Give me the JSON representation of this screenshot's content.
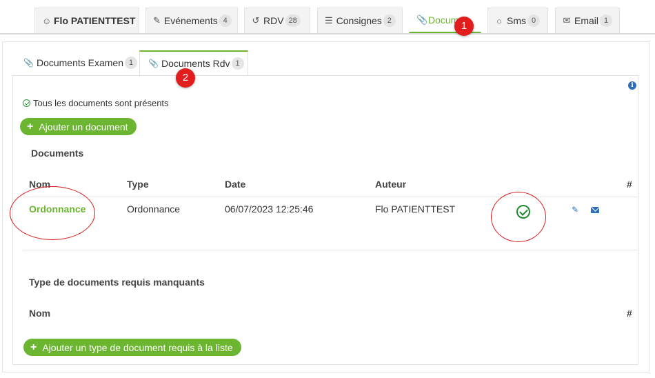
{
  "top_tabs": [
    {
      "icon": "user-icon",
      "label": "Flo PATIENTTEST",
      "badge": ""
    },
    {
      "icon": "pencil-icon",
      "label": "Evénements",
      "badge": "4"
    },
    {
      "icon": "history-icon",
      "label": "RDV",
      "badge": "28"
    },
    {
      "icon": "list-icon",
      "label": "Consignes",
      "badge": "2"
    },
    {
      "icon": "paperclip-icon",
      "label": "Docum",
      "badge": ""
    },
    {
      "icon": "comment-icon",
      "label": "Sms",
      "badge": "0"
    },
    {
      "icon": "envelope-icon",
      "label": "Email",
      "badge": "1"
    }
  ],
  "markers": [
    "1",
    "2"
  ],
  "sub_tabs": [
    {
      "icon": "paperclip-icon",
      "label": "Documents Examen",
      "badge": "1"
    },
    {
      "icon": "paperclip-icon",
      "label": "Documents Rdv",
      "badge": "1"
    }
  ],
  "status_text": "Tous les documents sont présents",
  "add_document_label": "Ajouter un document",
  "documents": {
    "title": "Documents",
    "columns": [
      "Nom",
      "Type",
      "Date",
      "Auteur",
      "#"
    ],
    "rows": [
      {
        "nom": "Ordonnance",
        "type": "Ordonnance",
        "date": "06/07/2023 12:25:46",
        "auteur": "Flo PATIENTTEST"
      }
    ]
  },
  "missing": {
    "title": "Type de documents requis manquants",
    "columns": [
      "Nom",
      "#"
    ],
    "add_label": "Ajouter un type de document requis à la liste"
  },
  "colors": {
    "accent": "#6bb531",
    "link_blue": "#2f6db5",
    "ok_green": "#1e8a2e",
    "annotation_red": "#d81b1b"
  }
}
